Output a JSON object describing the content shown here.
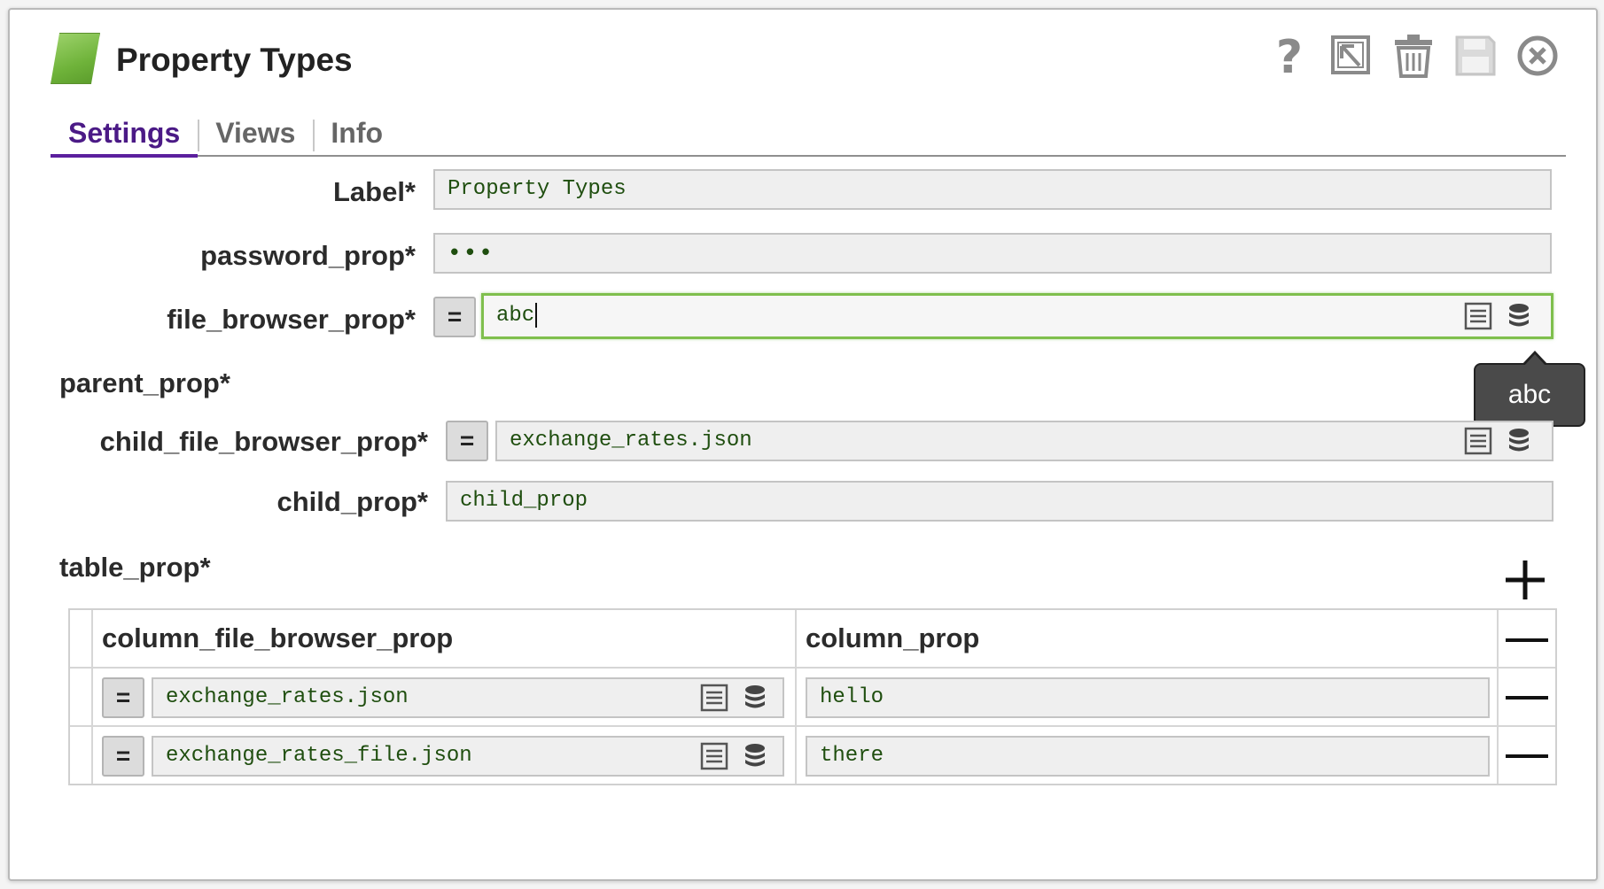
{
  "dialog": {
    "title": "Property Types",
    "toolbar": {
      "help": "question-icon",
      "export": "export-icon",
      "delete": "trash-icon",
      "save": "save-icon",
      "close": "close-icon"
    }
  },
  "tabs": [
    {
      "label": "Settings",
      "active": true
    },
    {
      "label": "Views",
      "active": false
    },
    {
      "label": "Info",
      "active": false
    }
  ],
  "form": {
    "label": {
      "label": "Label*",
      "value": "Property Types"
    },
    "password_prop": {
      "label": "password_prop*",
      "value": "•••"
    },
    "file_browser_prop": {
      "label": "file_browser_prop*",
      "value": "abc",
      "expr_label": "="
    },
    "tooltip": "abc",
    "parent_prop": {
      "label": "parent_prop*"
    },
    "child_file_browser_prop": {
      "label": "child_file_browser_prop*",
      "value": "exchange_rates.json",
      "expr_label": "="
    },
    "child_prop": {
      "label": "child_prop*",
      "value": "child_prop"
    },
    "table_prop": {
      "label": "table_prop*",
      "columns": [
        "column_file_browser_prop",
        "column_prop"
      ],
      "rows": [
        {
          "file": "exchange_rates.json",
          "prop": "hello",
          "expr_label": "="
        },
        {
          "file": "exchange_rates_file.json",
          "prop": "there",
          "expr_label": "="
        }
      ]
    }
  },
  "colors": {
    "accent": "#5b1f9e",
    "value_text": "#1f4e0f",
    "focus_border": "#7fbf4d"
  }
}
